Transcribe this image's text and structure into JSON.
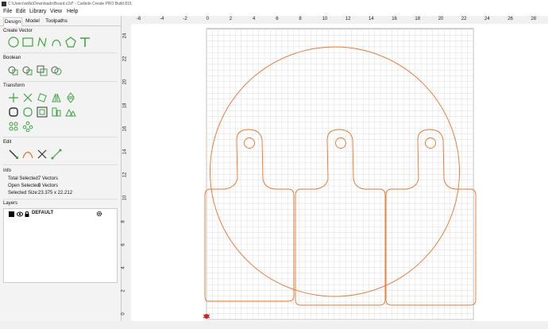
{
  "window": {
    "title": "C:\\Users\\willa\\Downloads\\Board.c2d* - Carbide Create PRO Build 815",
    "icon": "carbide-logo-icon"
  },
  "menu": [
    "File",
    "Edit",
    "Library",
    "View",
    "Help"
  ],
  "tabs": [
    {
      "label": "Design",
      "active": true
    },
    {
      "label": "Model",
      "active": false
    },
    {
      "label": "Toolpaths",
      "active": false
    }
  ],
  "sections": {
    "create_vector": "Create Vector",
    "boolean": "Boolean",
    "transform": "Transform",
    "edit": "Edit",
    "info": "Info",
    "layers": "Layers"
  },
  "info": {
    "total_selected_label": "Total Selected:",
    "total_selected_value": "7 Vectors",
    "open_selected_label": "Open Selected:",
    "open_selected_value": "0 Vectors",
    "selected_size_label": "Selected Size:",
    "selected_size_value": "23.375 x 22.212"
  },
  "layer": {
    "name": "DEFAULT",
    "color": "#000000",
    "icon_visible": "eye-icon",
    "icon_lock": "lock-icon",
    "icon_settings": "gear-icon"
  },
  "ruler_x": [
    "-6",
    "-4",
    "-2",
    "0",
    "2",
    "4",
    "6",
    "8",
    "10",
    "12",
    "14",
    "16",
    "18",
    "20",
    "22",
    "24",
    "26",
    "28"
  ],
  "ruler_y": [
    "24",
    "22",
    "20",
    "18",
    "16",
    "14",
    "12",
    "10",
    "8",
    "6",
    "4",
    "2",
    "0"
  ],
  "colors": {
    "vector": "#e8742a",
    "accent": "#3fa33f",
    "grid": "#d8d8d8",
    "origin": "#d9231c"
  }
}
